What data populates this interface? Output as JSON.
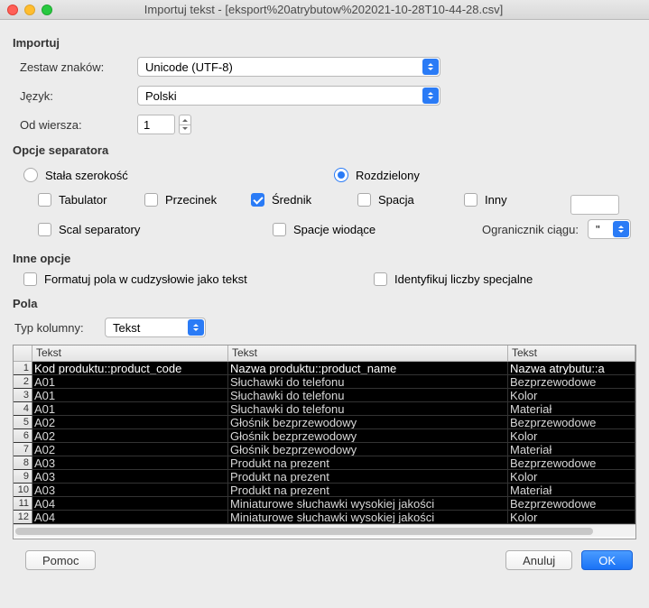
{
  "window": {
    "title": "Importuj tekst - [eksport%20atrybutow%202021-10-28T10-44-28.csv]"
  },
  "import": {
    "header": "Importuj",
    "charset_label": "Zestaw znaków:",
    "charset_value": "Unicode (UTF-8)",
    "lang_label": "Język:",
    "lang_value": "Polski",
    "fromrow_label": "Od wiersza:",
    "fromrow_value": "1"
  },
  "separator": {
    "header": "Opcje separatora",
    "fixed": "Stała szerokość",
    "delimited": "Rozdzielony",
    "tab": "Tabulator",
    "comma": "Przecinek",
    "semicolon": "Średnik",
    "space": "Spacja",
    "other": "Inny",
    "other_value": "",
    "merge": "Scal separatory",
    "leading": "Spacje wiodące",
    "quote_label": "Ogranicznik ciągu:",
    "quote_value": "\""
  },
  "other": {
    "header": "Inne opcje",
    "format_quoted": "Formatuj pola w cudzysłowie jako tekst",
    "detect_special": "Identyfikuj liczby specjalne"
  },
  "fields": {
    "header": "Pola",
    "coltype_label": "Typ kolumny:",
    "coltype_value": "Tekst",
    "columns": [
      "Tekst",
      "Tekst",
      "Tekst"
    ],
    "rows": [
      [
        "Kod produktu::product_code",
        "Nazwa produktu::product_name",
        "Nazwa atrybutu::a"
      ],
      [
        "A01",
        "Słuchawki do telefonu",
        "Bezprzewodowe"
      ],
      [
        "A01",
        "Słuchawki do telefonu",
        "Kolor"
      ],
      [
        "A01",
        "Słuchawki do telefonu",
        "Materiał"
      ],
      [
        "A02",
        "Głośnik bezprzewodowy",
        "Bezprzewodowe"
      ],
      [
        "A02",
        "Głośnik bezprzewodowy",
        "Kolor"
      ],
      [
        "A02",
        "Głośnik bezprzewodowy",
        "Materiał"
      ],
      [
        "A03",
        "Produkt na prezent",
        "Bezprzewodowe"
      ],
      [
        "A03",
        "Produkt na prezent",
        "Kolor"
      ],
      [
        "A03",
        "Produkt na prezent",
        "Materiał"
      ],
      [
        "A04",
        "Miniaturowe słuchawki wysokiej jakości",
        "Bezprzewodowe"
      ],
      [
        "A04",
        "Miniaturowe słuchawki wysokiej jakości",
        "Kolor"
      ]
    ]
  },
  "buttons": {
    "help": "Pomoc",
    "cancel": "Anuluj",
    "ok": "OK"
  }
}
